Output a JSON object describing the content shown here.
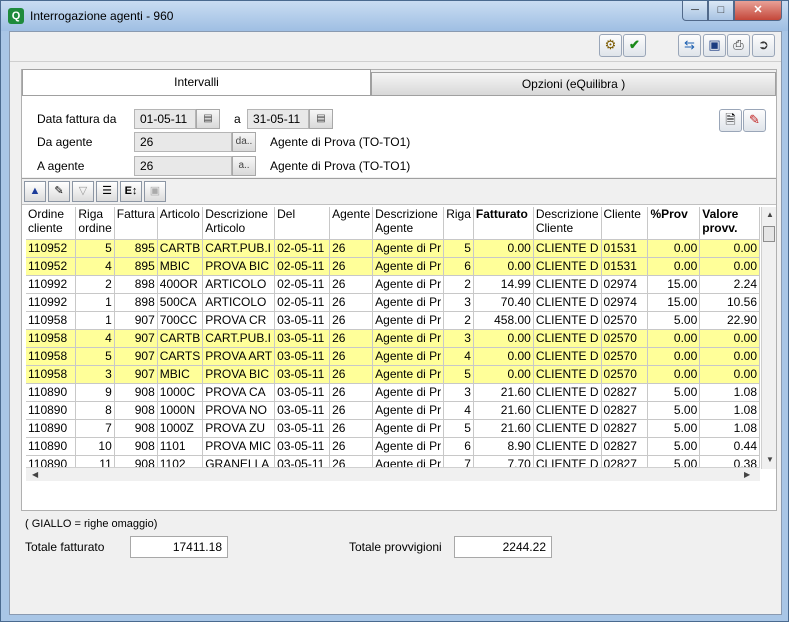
{
  "window": {
    "title": "Interrogazione agenti - 960",
    "app_icon_letter": "Q"
  },
  "tabs": {
    "active": "Intervalli",
    "inactive": "Opzioni (eQuilibra )"
  },
  "filters": {
    "data_fattura_label": "Data fattura  da",
    "data_from": "01-05-11",
    "a_label": "a",
    "data_to": "31-05-11",
    "da_agente_label": "Da agente",
    "da_agente_value": "26",
    "da_agente_btn": "da..",
    "da_agente_desc": "Agente di Prova   (TO-TO1)",
    "a_agente_label": "A agente",
    "a_agente_value": "26",
    "a_agente_btn": "a..",
    "a_agente_desc": "Agente di Prova   (TO-TO1)"
  },
  "table": {
    "headers": [
      "Ordine cliente",
      "Riga ordine",
      "Fattura",
      "Articolo",
      "Descrizione Articolo",
      "Del",
      "Agente",
      "Descrizione Agente",
      "Riga",
      "Fatturato",
      "Descrizione Cliente",
      "Cliente",
      "%Prov",
      "Valore provv."
    ],
    "rows": [
      {
        "gift": true,
        "cells": [
          "110952",
          "5",
          "895",
          "CARTB",
          "CART.PUB.I",
          "02-05-11",
          "26",
          "Agente di Pr",
          "5",
          "0.00",
          "CLIENTE D",
          "01531",
          "0.00",
          "0.00"
        ]
      },
      {
        "gift": true,
        "cells": [
          "110952",
          "4",
          "895",
          "MBIC",
          "PROVA BIC",
          "02-05-11",
          "26",
          "Agente di Pr",
          "6",
          "0.00",
          "CLIENTE D",
          "01531",
          "0.00",
          "0.00"
        ]
      },
      {
        "gift": false,
        "cells": [
          "110992",
          "2",
          "898",
          "400OR",
          "ARTICOLO",
          "02-05-11",
          "26",
          "Agente di Pr",
          "2",
          "14.99",
          "CLIENTE D",
          "02974",
          "15.00",
          "2.24"
        ]
      },
      {
        "gift": false,
        "cells": [
          "110992",
          "1",
          "898",
          "500CA",
          "ARTICOLO",
          "02-05-11",
          "26",
          "Agente di Pr",
          "3",
          "70.40",
          "CLIENTE D",
          "02974",
          "15.00",
          "10.56"
        ]
      },
      {
        "gift": false,
        "cells": [
          "110958",
          "1",
          "907",
          "700CC",
          "PROVA CR",
          "03-05-11",
          "26",
          "Agente di Pr",
          "2",
          "458.00",
          "CLIENTE D",
          "02570",
          "5.00",
          "22.90"
        ]
      },
      {
        "gift": true,
        "cells": [
          "110958",
          "4",
          "907",
          "CARTB",
          "CART.PUB.I",
          "03-05-11",
          "26",
          "Agente di Pr",
          "3",
          "0.00",
          "CLIENTE D",
          "02570",
          "0.00",
          "0.00"
        ]
      },
      {
        "gift": true,
        "cells": [
          "110958",
          "5",
          "907",
          "CARTS",
          "PROVA ART",
          "03-05-11",
          "26",
          "Agente di Pr",
          "4",
          "0.00",
          "CLIENTE D",
          "02570",
          "0.00",
          "0.00"
        ]
      },
      {
        "gift": true,
        "cells": [
          "110958",
          "3",
          "907",
          "MBIC",
          "PROVA BIC",
          "03-05-11",
          "26",
          "Agente di Pr",
          "5",
          "0.00",
          "CLIENTE D",
          "02570",
          "0.00",
          "0.00"
        ]
      },
      {
        "gift": false,
        "cells": [
          "110890",
          "9",
          "908",
          "1000C",
          "PROVA CA",
          "03-05-11",
          "26",
          "Agente di Pr",
          "3",
          "21.60",
          "CLIENTE D",
          "02827",
          "5.00",
          "1.08"
        ]
      },
      {
        "gift": false,
        "cells": [
          "110890",
          "8",
          "908",
          "1000N",
          "PROVA NO",
          "03-05-11",
          "26",
          "Agente di Pr",
          "4",
          "21.60",
          "CLIENTE D",
          "02827",
          "5.00",
          "1.08"
        ]
      },
      {
        "gift": false,
        "cells": [
          "110890",
          "7",
          "908",
          "1000Z",
          "PROVA ZU",
          "03-05-11",
          "26",
          "Agente di Pr",
          "5",
          "21.60",
          "CLIENTE D",
          "02827",
          "5.00",
          "1.08"
        ]
      },
      {
        "gift": false,
        "cells": [
          "110890",
          "10",
          "908",
          "1101",
          "PROVA MIC",
          "03-05-11",
          "26",
          "Agente di Pr",
          "6",
          "8.90",
          "CLIENTE D",
          "02827",
          "5.00",
          "0.44"
        ]
      },
      {
        "gift": false,
        "cells": [
          "110890",
          "11",
          "908",
          "1102",
          "GRANELLA",
          "03-05-11",
          "26",
          "Agente di Pr",
          "7",
          "7.70",
          "CLIENTE D",
          "02827",
          "5.00",
          "0.38"
        ]
      }
    ]
  },
  "footer": {
    "legend": "( GIALLO = righe omaggio)",
    "totale_fatturato_label": "Totale fatturato",
    "totale_fatturato": "17411.18",
    "totale_provvigioni_label": "Totale provvigioni",
    "totale_provvigioni": "2244.22"
  },
  "colors": {
    "gift_row": "#ffff99",
    "title_gradient_top": "#c9dcf2",
    "close_button": "#c4473a"
  }
}
